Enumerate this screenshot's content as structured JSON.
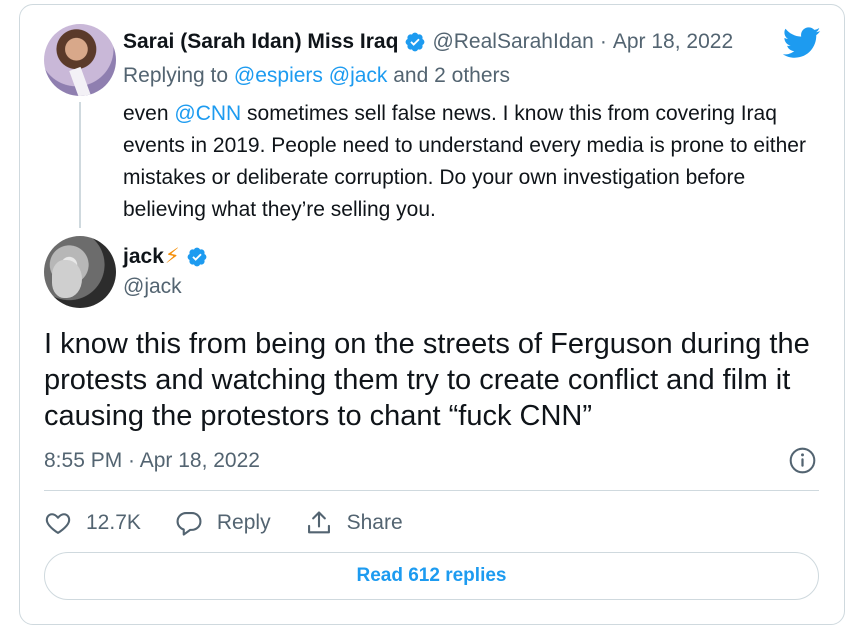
{
  "reply_tweet": {
    "name": "Sarai (Sarah Idan) Miss Iraq",
    "handle": "@RealSarahIdan",
    "separator": "·",
    "date": "Apr 18, 2022",
    "replying_prefix": "Replying to ",
    "replying_mentions": "@espiers @jack",
    "replying_suffix": " and 2 others",
    "text_before": "even ",
    "text_mention": "@CNN",
    "text_after": " sometimes sell false news. I know this from covering Iraq events in 2019. People need to understand every media is prone to either mistakes or deliberate corruption. Do your own investigation before believing what they’re selling you."
  },
  "main_tweet": {
    "name": "jack",
    "name_emoji": "⚡",
    "handle": "@jack",
    "text": "I know this from being on the streets of Ferguson during the protests and watching them try to create conflict and film it causing the protestors to chant “fuck CNN”",
    "timestamp": "8:55 PM · Apr 18, 2022"
  },
  "actions": {
    "like_count": "12.7K",
    "reply_label": "Reply",
    "share_label": "Share"
  },
  "read_replies_label": "Read 612 replies",
  "icons": {
    "verified": "verified-badge-icon",
    "brand": "twitter-bird-icon",
    "info": "info-icon",
    "like": "heart-icon",
    "reply": "reply-icon",
    "share": "share-icon"
  },
  "colors": {
    "accent": "#1d9bf0",
    "secondary_text": "#536471",
    "primary_text": "#0f1419",
    "border": "#cfd9de",
    "bolt": "#f4900c"
  }
}
